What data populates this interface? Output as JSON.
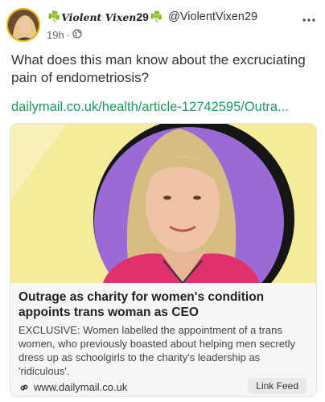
{
  "post": {
    "author": {
      "display_name_prefix": "☘️",
      "display_name": "Violent Vixen",
      "display_name_num": "29",
      "display_name_suffix": "☘️",
      "handle": "@ViolentVixen29"
    },
    "time": "19h",
    "dot": "·",
    "text": "What does this man know about the excruciating pain of endometriosis?",
    "link": "dailymail.co.uk/health/article-12742595/Outra..."
  },
  "card": {
    "title": "Outrage as charity for women's condition appoints trans woman as CEO",
    "description": "EXCLUSIVE: Women labelled the appointment of a trans women, who previously boasted about helping men secretly dress up as schoolgirls to the charity's leadership as 'ridiculous'.",
    "url": "www.dailymail.co.uk",
    "link_feed_label": "Link Feed"
  },
  "colors": {
    "link": "#1a9a5c",
    "shamrock": "#2e9a35",
    "card_bg_yellow": "#f4ec9b",
    "card_bg_purple": "#9a6ad6",
    "jacket": "#e0306e"
  },
  "icons": [
    "more-options-icon",
    "globe-icon",
    "link-icon",
    "shamrock-icon"
  ]
}
